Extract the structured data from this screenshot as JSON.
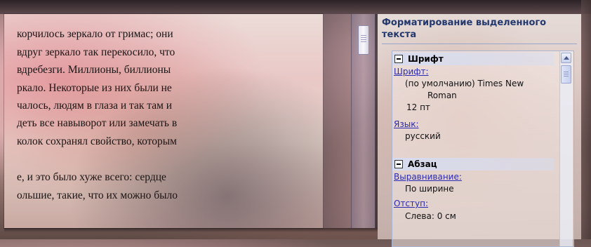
{
  "document": {
    "lines": [
      "корчилось зеркало от гримас; они",
      "вдруг зеркало так перекосило, что",
      "вдребезги. Миллионы, биллионы",
      "ркало. Некоторые из них были не",
      "чалось, людям в глаза и так там и",
      "деть все навыворот или замечать в",
      "колок сохранял свойство, которым",
      "",
      "е, и это было хуже всего: сердце",
      "ольшие, такие, что их можно было",
      "                    "
    ]
  },
  "task_pane": {
    "title": "Форматирование выделенного текста",
    "sections": [
      {
        "header": "Шрифт",
        "props": [
          {
            "link": "Шрифт:",
            "values": [
              "(по умолчанию) Times New",
              "Roman",
              "12 пт"
            ]
          },
          {
            "link": "Язык:",
            "values": [
              "русский"
            ]
          }
        ]
      },
      {
        "header": "Абзац",
        "props": [
          {
            "link": "Выравнивание:",
            "values": [
              "По ширине"
            ]
          },
          {
            "link": "Отступ:",
            "values": [
              "Слева:  0 см"
            ]
          }
        ]
      }
    ]
  },
  "icons": {
    "collapse": "minus-box-icon",
    "scroll_up": "chevron-up-icon"
  },
  "colors": {
    "title": "#22386e",
    "link": "#2a2ab5",
    "section_bg": "#d6dcf0"
  }
}
